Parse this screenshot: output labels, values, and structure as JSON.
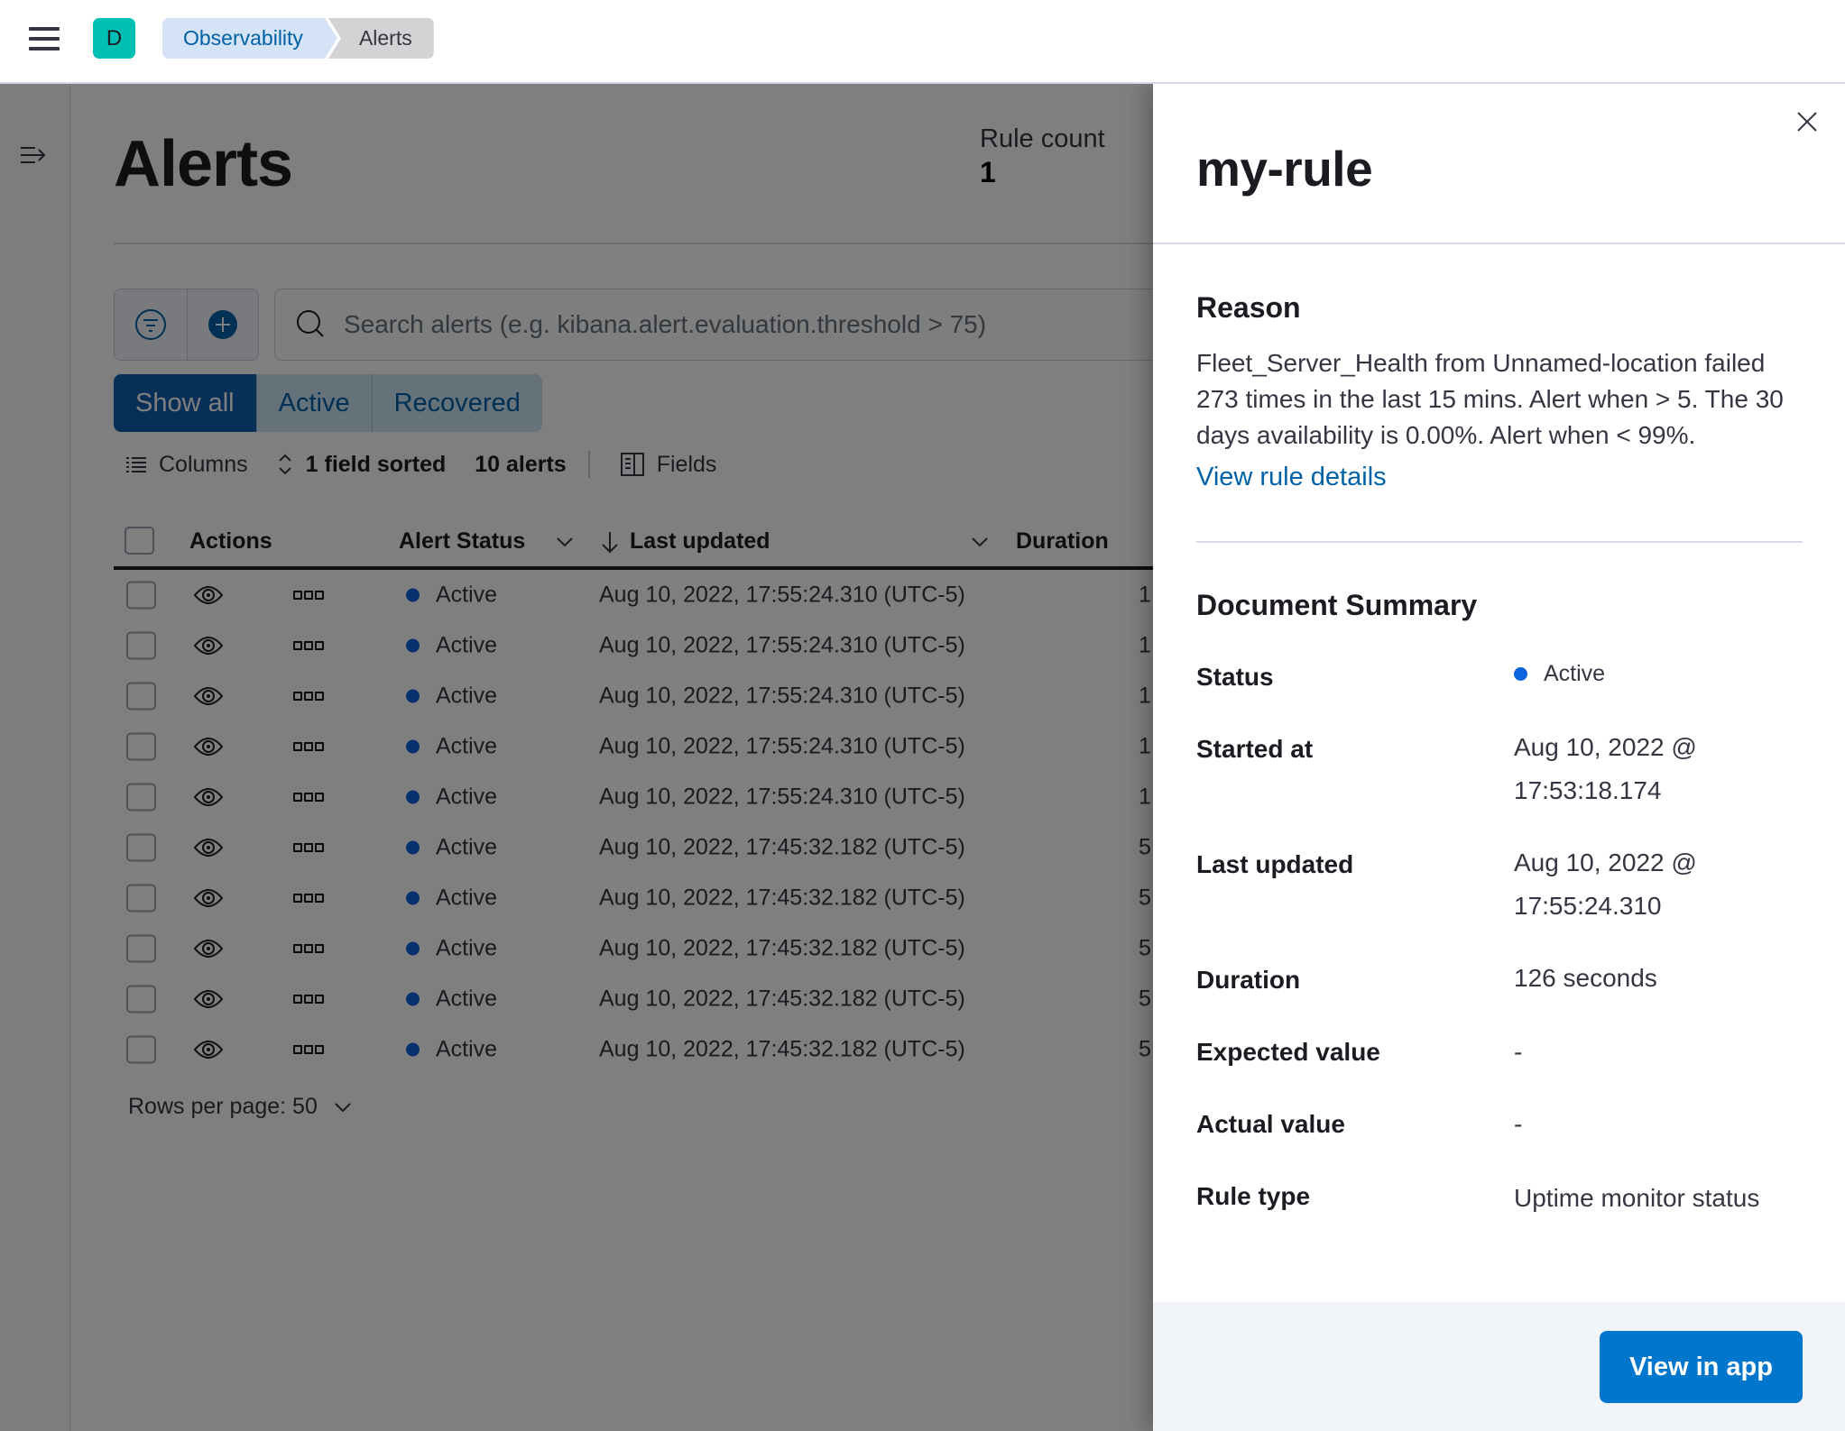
{
  "header": {
    "space_initial": "D",
    "breadcrumbs": [
      {
        "label": "Observability"
      },
      {
        "label": "Alerts"
      }
    ]
  },
  "page": {
    "title": "Alerts",
    "stats": [
      {
        "label": "Rule count",
        "value": "1"
      }
    ],
    "search": {
      "placeholder": "Search alerts (e.g. kibana.alert.evaluation.threshold > 75)",
      "value": ""
    },
    "status_filter": {
      "options": [
        "Show all",
        "Active",
        "Recovered"
      ],
      "selected": "Show all"
    },
    "toolbar": {
      "columns_label": "Columns",
      "sort_label": "1 field sorted",
      "count_label": "10 alerts",
      "fields_label": "Fields"
    },
    "table": {
      "columns": [
        "Actions",
        "Alert Status",
        "Last updated",
        "Duration"
      ],
      "rows": [
        {
          "status": "Active",
          "last_updated": "Aug 10, 2022, 17:55:24.310 (UTC-5)",
          "duration": "1"
        },
        {
          "status": "Active",
          "last_updated": "Aug 10, 2022, 17:55:24.310 (UTC-5)",
          "duration": "1"
        },
        {
          "status": "Active",
          "last_updated": "Aug 10, 2022, 17:55:24.310 (UTC-5)",
          "duration": "1"
        },
        {
          "status": "Active",
          "last_updated": "Aug 10, 2022, 17:55:24.310 (UTC-5)",
          "duration": "1"
        },
        {
          "status": "Active",
          "last_updated": "Aug 10, 2022, 17:55:24.310 (UTC-5)",
          "duration": "1"
        },
        {
          "status": "Active",
          "last_updated": "Aug 10, 2022, 17:45:32.182 (UTC-5)",
          "duration": "5"
        },
        {
          "status": "Active",
          "last_updated": "Aug 10, 2022, 17:45:32.182 (UTC-5)",
          "duration": "5"
        },
        {
          "status": "Active",
          "last_updated": "Aug 10, 2022, 17:45:32.182 (UTC-5)",
          "duration": "5"
        },
        {
          "status": "Active",
          "last_updated": "Aug 10, 2022, 17:45:32.182 (UTC-5)",
          "duration": "5"
        },
        {
          "status": "Active",
          "last_updated": "Aug 10, 2022, 17:45:32.182 (UTC-5)",
          "duration": "5"
        }
      ]
    },
    "rows_per_page": "Rows per page: 50"
  },
  "flyout": {
    "title": "my-rule",
    "reason_heading": "Reason",
    "reason_text": "Fleet_Server_Health from Unnamed-location failed 273 times in the last 15 mins. Alert when > 5. The 30 days availability is 0.00%. Alert when < 99%.",
    "view_rule_details": "View rule details",
    "summary_heading": "Document Summary",
    "summary": {
      "status_label": "Status",
      "status_value": "Active",
      "started_label": "Started at",
      "started_value": "Aug 10, 2022 @ 17:53:18.174",
      "updated_label": "Last updated",
      "updated_value": "Aug 10, 2022 @ 17:55:24.310",
      "duration_label": "Duration",
      "duration_value": "126 seconds",
      "expected_label": "Expected value",
      "expected_value": "-",
      "actual_label": "Actual value",
      "actual_value": "-",
      "rule_type_label": "Rule type",
      "rule_type_value": "Uptime monitor status"
    },
    "view_in_app": "View in app"
  },
  "colors": {
    "primary": "#0077cc",
    "status_active": "#0b64dd",
    "link": "#0061a6"
  }
}
